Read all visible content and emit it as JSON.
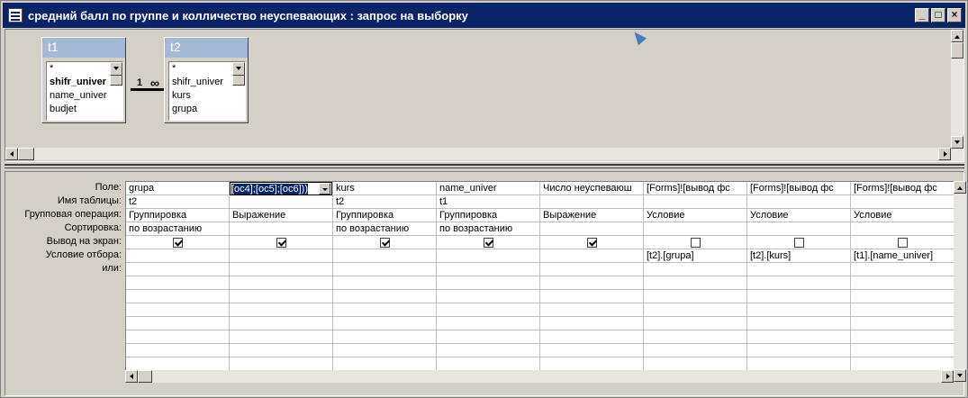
{
  "window": {
    "title": "средний балл по группе и колличество неуспевающих : запрос на выборку",
    "minimize": "_",
    "maximize": "□",
    "close": "×"
  },
  "tables": [
    {
      "name": "t1",
      "fields": [
        "*",
        "shifr_univer",
        "name_univer",
        "budjet"
      ],
      "bold_field_index": 1
    },
    {
      "name": "t2",
      "fields": [
        "*",
        "shifr_univer",
        "kurs",
        "grupa"
      ]
    }
  ],
  "relationship": {
    "one": "1",
    "many": "∞"
  },
  "row_labels": [
    "Поле:",
    "Имя таблицы:",
    "Групповая операция:",
    "Сортировка:",
    "Вывод на экран:",
    "Условие отбора:",
    "или:"
  ],
  "columns": [
    {
      "field": "grupa",
      "table": "t2",
      "group": "Группировка",
      "sort": "по возрастанию",
      "show": true,
      "criteria": ""
    },
    {
      "field": "[oc4];[oc5];[oc6]))",
      "table": "",
      "group": "Выражение",
      "sort": "",
      "show": true,
      "criteria": "",
      "selected": true
    },
    {
      "field": "kurs",
      "table": "t2",
      "group": "Группировка",
      "sort": "по возрастанию",
      "show": true,
      "criteria": ""
    },
    {
      "field": "name_univer",
      "table": "t1",
      "group": "Группировка",
      "sort": "по возрастанию",
      "show": true,
      "criteria": ""
    },
    {
      "field": "Число неуспеваюш",
      "table": "",
      "group": "Выражение",
      "sort": "",
      "show": true,
      "criteria": ""
    },
    {
      "field": "[Forms]![вывод фс",
      "table": "",
      "group": "Условие",
      "sort": "",
      "show": false,
      "criteria": "[t2].[grupa]"
    },
    {
      "field": "[Forms]![вывод фс",
      "table": "",
      "group": "Условие",
      "sort": "",
      "show": false,
      "criteria": "[t2].[kurs]"
    },
    {
      "field": "[Forms]![вывод фс",
      "table": "",
      "group": "Условие",
      "sort": "",
      "show": false,
      "criteria": "[t1].[name_univer]"
    }
  ]
}
